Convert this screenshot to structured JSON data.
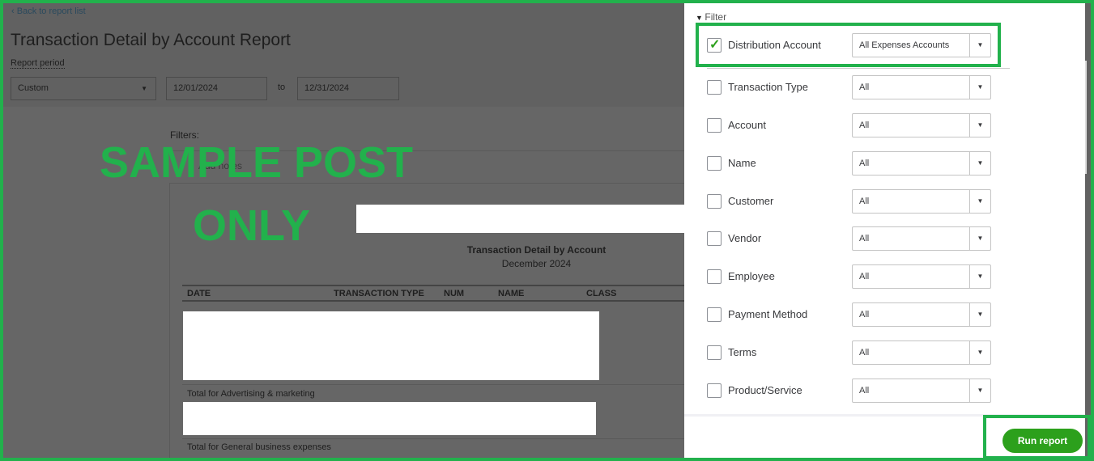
{
  "header": {
    "back_link": "Back to report list",
    "title": "Transaction Detail by Account Report",
    "report_period_label": "Report period",
    "period_select": "Custom",
    "from_date": "12/01/2024",
    "to_label": "to",
    "to_date": "12/31/2024"
  },
  "report": {
    "filters_label": "Filters:",
    "notes_label": "Add notes",
    "title": "Transaction Detail by Account",
    "subtitle": "December 2024",
    "columns": [
      "DATE",
      "TRANSACTION TYPE",
      "NUM",
      "NAME",
      "CLASS"
    ],
    "totals": [
      "Total for Advertising & marketing",
      "Total for General business expenses"
    ]
  },
  "watermark": {
    "line1": "SAMPLE POST",
    "line2": "ONLY"
  },
  "filter_panel": {
    "title": "Filter",
    "filters": [
      {
        "label": "Distribution Account",
        "value": "All Expenses Accounts",
        "checked": true
      },
      {
        "label": "Transaction Type",
        "value": "All",
        "checked": false
      },
      {
        "label": "Account",
        "value": "All",
        "checked": false
      },
      {
        "label": "Name",
        "value": "All",
        "checked": false
      },
      {
        "label": "Customer",
        "value": "All",
        "checked": false
      },
      {
        "label": "Vendor",
        "value": "All",
        "checked": false
      },
      {
        "label": "Employee",
        "value": "All",
        "checked": false
      },
      {
        "label": "Payment Method",
        "value": "All",
        "checked": false
      },
      {
        "label": "Terms",
        "value": "All",
        "checked": false
      },
      {
        "label": "Product/Service",
        "value": "All",
        "checked": false
      }
    ],
    "run_button": "Run report"
  },
  "colors": {
    "accent": "#2ca01c",
    "highlight": "#22b14c"
  }
}
